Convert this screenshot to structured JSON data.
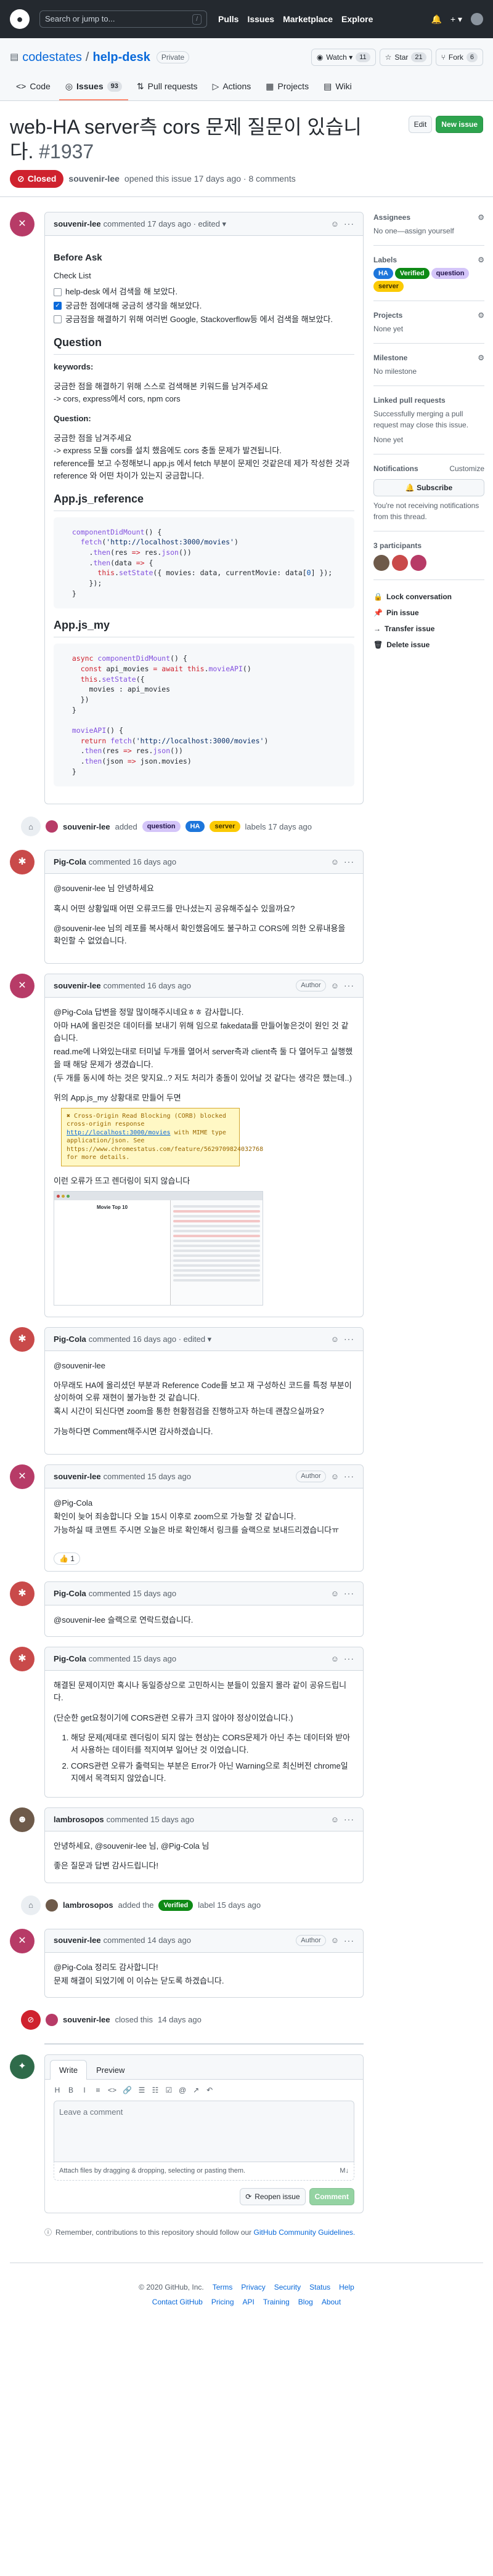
{
  "header": {
    "search_placeholder": "Search or jump to...",
    "search_key": "/",
    "nav": [
      "Pulls",
      "Issues",
      "Marketplace",
      "Explore"
    ],
    "plus": "+ ▾",
    "bell": "🔔"
  },
  "repo": {
    "owner": "codestates",
    "sep": "/",
    "name": "help-desk",
    "visibility": "Private",
    "watch_label": "Watch ▾",
    "watch_count": "11",
    "star_label": "Star",
    "star_count": "21",
    "fork_label": "Fork",
    "fork_count": "6"
  },
  "tabs": [
    {
      "label": "Code",
      "icon": "<>"
    },
    {
      "label": "Issues",
      "icon": "◎",
      "count": "93"
    },
    {
      "label": "Pull requests",
      "icon": "⇅"
    },
    {
      "label": "Actions",
      "icon": "▷"
    },
    {
      "label": "Projects",
      "icon": "▦"
    },
    {
      "label": "Wiki",
      "icon": "▤"
    }
  ],
  "issue": {
    "title": "web-HA server측 cors 문제 질문이 있습니다.",
    "number": "#1937",
    "edit_label": "Edit",
    "new_issue_label": "New issue",
    "state": "Closed",
    "author": "souvenir-lee",
    "meta_text": "opened this issue 17 days ago · 8 comments"
  },
  "comments": {
    "c1": {
      "author": "souvenir-lee",
      "meta": "commented 17 days ago · edited ▾",
      "before_ask": "Before Ask",
      "checklist_title": "Check List",
      "checklist": [
        {
          "text": "help-desk 에서 검색을 해 보았다.",
          "checked": false
        },
        {
          "text": "궁금한 점에대해 궁금히 생각을 해보았다.",
          "checked": true
        },
        {
          "text": "궁금점을 해결하기 위해 여러번 Google, Stackoverflow등 에서 검색을 해보았다.",
          "checked": false
        }
      ],
      "question_h": "Question",
      "keywords_h": "keywords:",
      "keywords_1": "궁금한 점을 해결하기 위해 스스로 검색해본 키워드를 남겨주세요",
      "keywords_2": "-> cors, express에서 cors, npm cors",
      "question_label": "Question:",
      "question_1": "궁금한 점을 남겨주세요",
      "question_2": "-> express 모듈 cors를 설치 했음에도 cors 충돌 문제가 발견됩니다.",
      "question_3": "reference를 보고 수정해보니 app.js 에서 fetch 부분이 문제인 것같은데 제가 작성한 것과 reference 와 어떤 차이가 있는지 궁금합니다.",
      "appjs_ref_h": "App.js_reference",
      "appjs_my_h": "App.js_my"
    },
    "c2": {
      "author": "Pig-Cola",
      "meta": "commented 16 days ago",
      "p1": "@souvenir-lee 님 안녕하세요",
      "p2": "혹시 어떤 상황일때 어떤 오류코드를 만나셨는지 공유해주실수 있을까요?",
      "p3": "@souvenir-lee 님의 레포를 복사해서 확인했음에도 불구하고 CORS에 의한 오류내용을 확인할 수 없었습니다."
    },
    "c3": {
      "author": "souvenir-lee",
      "meta": "commented 16 days ago",
      "role": "Author",
      "p1": "@Pig-Cola 답변을 정말 많이해주시네요ㅎㅎ 감사합니다.",
      "p2": "아마 HA에 올린것은 데이터를 보내기 위해 임으로 fakedata를 만들어놓은것이 원인 것 같습니다.",
      "p3": "read.me에 나와있는대로 터미널 두개를 열어서 server측과 client측 둘 다 열어두고 실행했을 때 해당 문제가 생겼습니다.",
      "p4": "(두 개를 동시에 하는 것은 맞지요..? 저도 처리가 충돌이 있어날 것 같다는 생각은 했는데..)",
      "p5": "위의 App.js_my 상황대로 만들어 두면",
      "err_text": "✖ Cross-Origin Read Blocking (CORB) blocked cross-origin response ",
      "err_link": "http://localhost:3000/movies",
      "err_tail": " with MIME type application/json. See https://www.chromestatus.com/feature/5629709824032768 for more details.",
      "p6": "이런 오류가 뜨고 렌더링이 되지 않습니다",
      "shot_title": "Movie Top 10"
    },
    "c4": {
      "author": "Pig-Cola",
      "meta": "commented 16 days ago · edited ▾",
      "p1": "@souvenir-lee",
      "p2": "아무래도 HA에 올리셨던 부분과 Reference Code를 보고 재 구성하신 코드를 특정 부분이 상이하여 오류 재현이 불가능한 것 같습니다.",
      "p3": "혹시 시간이 되신다면 zoom을 통한 현황점검을 진행하고자 하는데 괜찮으실까요?",
      "p4": "가능하다면 Comment해주시면 감사하겠습니다."
    },
    "c5": {
      "author": "souvenir-lee",
      "meta": "commented 15 days ago",
      "role": "Author",
      "p1": "@Pig-Cola",
      "p2": "확인이 늦어 죄송합니다 오늘 15시 이후로 zoom으로 가능할 것 같습니다.",
      "p3": "가능하실 때 코멘트 주시면 오늘은 바로 확인해서 링크를 슬랙으로 보내드리겠습니다ㅠ",
      "reaction": "👍 1"
    },
    "c6": {
      "author": "Pig-Cola",
      "meta": "commented 15 days ago",
      "p1": "@souvenir-lee 슬랙으로 연락드렸습니다."
    },
    "c7": {
      "author": "Pig-Cola",
      "meta": "commented 15 days ago",
      "p1": "해결된 문제이지만 혹시나 동일증상으로 고민하시는 분들이 있을지 몰라 같이 공유드립니다.",
      "p2": "(단순한 get요청이기에 CORS관련 오류가 크지 않아야 정상이었습니다.)",
      "li1": "해당 문제(제대로 렌더링이 되지 않는 현상)는 CORS문제가 아닌 추는 데이터와 받아서 사용하는 데이터를 적지여부 일어난 것 이었습니다.",
      "li2": "CORS관련 오류가 출력되는 부분은 Error가 아닌 Warning으로 최신버전 chrome일지에서 목격되지 않았습니다."
    },
    "c8": {
      "author": "lambrosopos",
      "meta": "commented 15 days ago",
      "p1": "안녕하세요, @souvenir-lee 님, @Pig-Cola 님",
      "p2": "좋은 질문과 답변 감사드립니다!"
    },
    "c9": {
      "author": "souvenir-lee",
      "meta": "commented 14 days ago",
      "role": "Author",
      "p1": "@Pig-Cola 정리도 감사합니다!",
      "p2": "문제 해결이 되었기에 이 이슈는 닫도록 하겠습니다."
    }
  },
  "events": {
    "e1": {
      "actor": "souvenir-lee",
      "verb": "added",
      "suffix": "labels 17 days ago"
    },
    "e2": {
      "actor": "lambrosopos",
      "verb": "added the",
      "suffix": "label 15 days ago"
    },
    "e3": {
      "actor": "souvenir-lee",
      "verb": "closed this",
      "suffix": "14 days ago"
    }
  },
  "labels": {
    "question": "question",
    "ha": "HA",
    "server": "server",
    "verified": "Verified"
  },
  "new_comment": {
    "write_tab": "Write",
    "preview_tab": "Preview",
    "toolbar": [
      "H",
      "B",
      "I",
      "≡",
      "<>",
      "🔗",
      "☰",
      "☷",
      "☑",
      "@",
      "↗",
      "↶"
    ],
    "placeholder": "Leave a comment",
    "attach": "Attach files by dragging & dropping, selecting or pasting them.",
    "reopen_label": "Reopen issue",
    "comment_label": "Comment",
    "remind_text": "Remember, contributions to this repository should follow our",
    "remind_link": "GitHub Community Guidelines."
  },
  "sidebar": {
    "assignees_title": "Assignees",
    "assignees_value": "No one—assign yourself",
    "labels_title": "Labels",
    "projects_title": "Projects",
    "projects_value": "None yet",
    "milestone_title": "Milestone",
    "milestone_value": "No milestone",
    "linked_title": "Linked pull requests",
    "linked_value": "Successfully merging a pull request may close this issue.",
    "linked_value2": "None yet",
    "notif_title": "Notifications",
    "notif_customize": "Customize",
    "subscribe_label": "🔔 Subscribe",
    "notif_value": "You're not receiving notifications from this thread.",
    "participants_title": "3 participants",
    "lock_label": "Lock conversation",
    "pin_label": "Pin issue",
    "transfer_label": "Transfer issue",
    "delete_label": "Delete issue",
    "gear": "⚙"
  },
  "footer": {
    "copyright": "© 2020 GitHub, Inc.",
    "row1": [
      "Terms",
      "Privacy",
      "Security",
      "Status",
      "Help"
    ],
    "row2": [
      "Contact GitHub",
      "Pricing",
      "API",
      "Training",
      "Blog",
      "About"
    ]
  },
  "colors": {
    "accent": "#0969da",
    "closed": "#cf222e",
    "green": "#2da44e"
  }
}
